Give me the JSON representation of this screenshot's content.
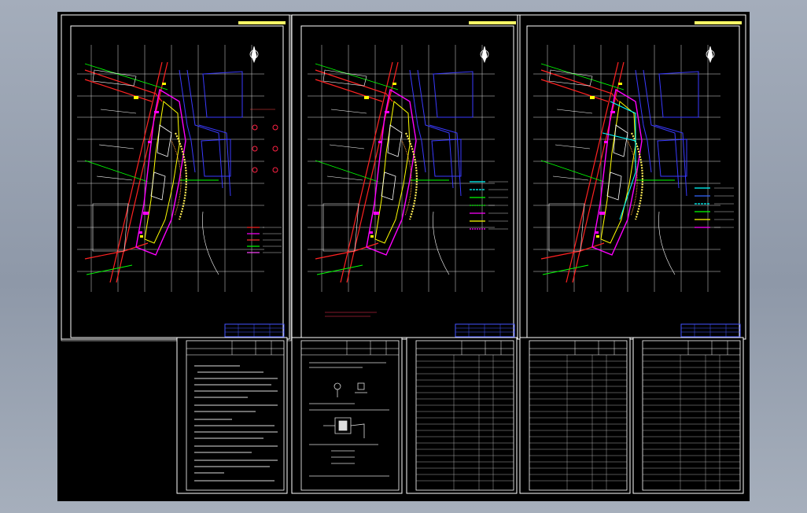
{
  "app": {
    "view_background": "#000000",
    "outer_background": "#9aa3b2"
  },
  "sheets": [
    {
      "id": "sheet-1",
      "kind": "site-plan-legend-symbols"
    },
    {
      "id": "sheet-2",
      "kind": "site-plan-legend-lines"
    },
    {
      "id": "sheet-3",
      "kind": "site-plan-legend-lines"
    }
  ],
  "tables": [
    {
      "id": "table-notes",
      "kind": "text-notes"
    },
    {
      "id": "table-details",
      "kind": "detail-drawings"
    },
    {
      "id": "table-list-1",
      "kind": "list"
    },
    {
      "id": "table-list-2",
      "kind": "list"
    },
    {
      "id": "table-list-3",
      "kind": "list"
    }
  ],
  "colors": {
    "frame": "#ffffff",
    "grid": "#e6e6e6",
    "red": "#ff2020",
    "magenta": "#ff00ff",
    "yellow": "#ffff00",
    "green": "#00ff00",
    "blue": "#3030ff",
    "cyan": "#00ffff",
    "titlebar": "#ffff66"
  }
}
